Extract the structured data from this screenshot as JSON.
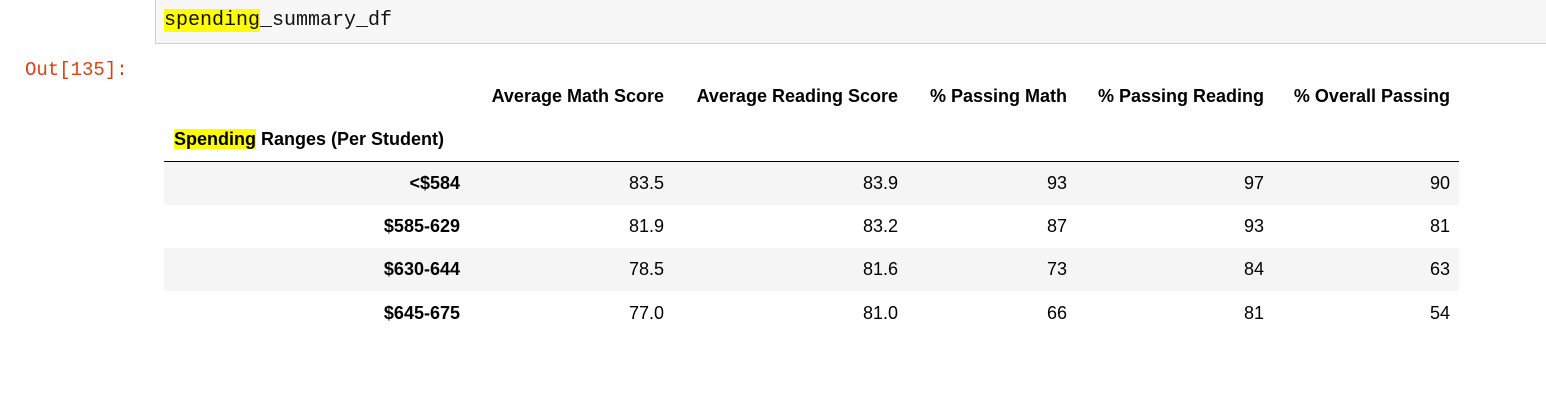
{
  "input_cell": {
    "code_highlight": "spending",
    "code_rest": "_summary_df"
  },
  "output_prompt": "Out[135]:",
  "dataframe": {
    "columns": [
      "Average Math Score",
      "Average Reading Score",
      "% Passing Math",
      "% Passing Reading",
      "% Overall Passing"
    ],
    "index_name_highlight": "Spending",
    "index_name_rest": " Ranges (Per Student)",
    "rows": [
      {
        "index": "<$584",
        "values": [
          "83.5",
          "83.9",
          "93",
          "97",
          "90"
        ]
      },
      {
        "index": "$585-629",
        "values": [
          "81.9",
          "83.2",
          "87",
          "93",
          "81"
        ]
      },
      {
        "index": "$630-644",
        "values": [
          "78.5",
          "81.6",
          "73",
          "84",
          "63"
        ]
      },
      {
        "index": "$645-675",
        "values": [
          "77.0",
          "81.0",
          "66",
          "81",
          "54"
        ]
      }
    ]
  }
}
